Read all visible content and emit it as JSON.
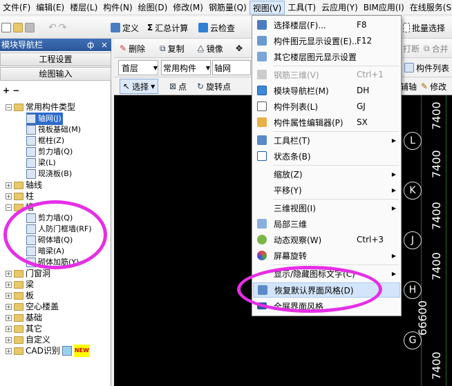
{
  "menubar": {
    "items": [
      "文件(F)",
      "编辑(E)",
      "楼层(L)",
      "构件(N)",
      "绘图(D)",
      "修改(M)",
      "钢筋量(Q)",
      "视图(V)",
      "工具(T)",
      "云应用(Y)",
      "BIM应用(I)",
      "在线服务(S"
    ]
  },
  "toolbar1": {
    "define": "定义",
    "sum": "汇总计算",
    "cloud_check": "云检查",
    "batch_select": "批量选择"
  },
  "toolbar2": {
    "delete": "删除",
    "copy": "复制",
    "mirror": "镜像",
    "split": "打断",
    "merge": "合并"
  },
  "toolbar3": {
    "floor": "首层",
    "type": "常用构件",
    "axis": "轴网",
    "component_list": "构件列表"
  },
  "toolbar4": {
    "select": "选择",
    "point": "点",
    "rotate_point": "旋转点",
    "offset_axis": "辅轴",
    "modify": "修改"
  },
  "panel": {
    "title": "模块导航栏",
    "pin": "ф",
    "close": "×",
    "btn_project": "工程设置",
    "btn_draw": "绘图输入"
  },
  "tree": {
    "common_group": "常用构件类型",
    "common_items": [
      "轴网(J)",
      "筏板基础(M)",
      "框柱(Z)",
      "剪力墙(Q)",
      "梁(L)",
      "现浇板(B)"
    ],
    "axis": "轴线",
    "column": "柱",
    "wall": "墙",
    "wall_items": [
      "剪力墙(Q)",
      "人防门框墙(RF)",
      "砌体墙(Q)",
      "暗梁(A)",
      "砌体加筋(Y)"
    ],
    "door": "门窗洞",
    "beam": "梁",
    "slab": "板",
    "hollow": "空心楼盖",
    "foundation": "基础",
    "other": "其它",
    "custom": "自定义",
    "cad": "CAD识别",
    "new_badge": "NEW"
  },
  "canvas": {
    "axes": [
      "L",
      "K",
      "J",
      "H",
      "G"
    ],
    "dims": [
      "7400",
      "7400",
      "7400",
      "7400",
      "66600",
      "7400"
    ]
  },
  "viewmenu": {
    "items": [
      {
        "label": "选择楼层(F)...",
        "shortcut": "F8"
      },
      {
        "label": "构件图元显示设置(E)...",
        "shortcut": "F12"
      },
      {
        "label": "其它楼层图元显示设置"
      },
      {
        "label": "钢筋三维(V)",
        "shortcut": "Ctrl+1"
      },
      {
        "label": "模块导航栏(M)",
        "shortcut": "DH"
      },
      {
        "label": "构件列表(L)",
        "shortcut": "GJ"
      },
      {
        "label": "构件属性编辑器(P)",
        "shortcut": "SX"
      },
      {
        "label": "工具栏(T)"
      },
      {
        "label": "状态条(B)"
      },
      {
        "label": "缩放(Z)"
      },
      {
        "label": "平移(Y)"
      },
      {
        "label": "三维视图(I)"
      },
      {
        "label": "局部三维"
      },
      {
        "label": "动态观察(W)",
        "shortcut": "Ctrl+3"
      },
      {
        "label": "屏幕旋转"
      },
      {
        "label": "显示/隐藏图标文字(C)"
      },
      {
        "label": "恢复默认界面风格(D)"
      },
      {
        "label": "全屏界面风格"
      }
    ]
  }
}
